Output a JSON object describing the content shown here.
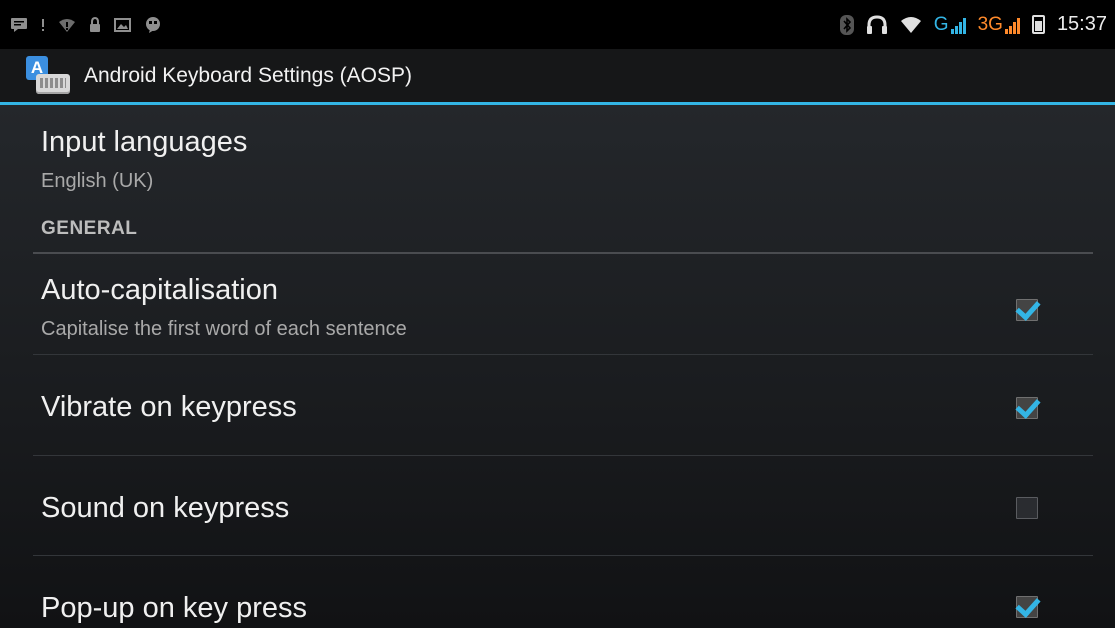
{
  "status_bar": {
    "left_icons": [
      "message-icon",
      "alert-icon",
      "wifi-alert-icon",
      "lock-icon",
      "image-icon",
      "chat-icon"
    ],
    "network_1": "G",
    "network_2": "3G",
    "time": "15:37"
  },
  "action_bar": {
    "title": "Android Keyboard Settings (AOSP)"
  },
  "input_languages": {
    "title": "Input languages",
    "summary": "English (UK)"
  },
  "section": {
    "header": "GENERAL"
  },
  "preferences": [
    {
      "title": "Auto-capitalisation",
      "summary": "Capitalise the first word of each sentence",
      "checked": true
    },
    {
      "title": "Vibrate on keypress",
      "summary": "",
      "checked": true
    },
    {
      "title": "Sound on keypress",
      "summary": "",
      "checked": false
    },
    {
      "title": "Pop-up on key press",
      "summary": "",
      "checked": true
    }
  ],
  "colors": {
    "accent": "#33b5e5",
    "network_orange": "#ff8a2b",
    "background": "#1a1c1f"
  }
}
